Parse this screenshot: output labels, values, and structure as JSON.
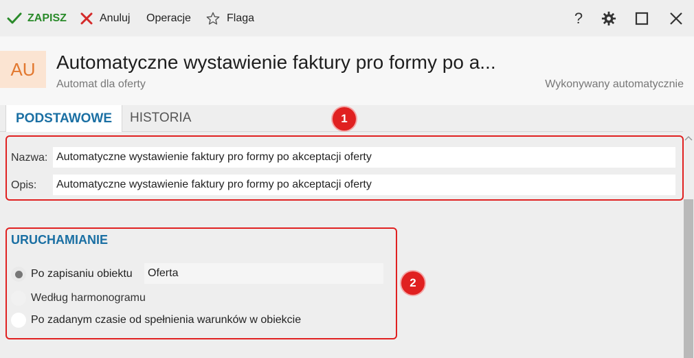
{
  "toolbar": {
    "save_label": "ZAPISZ",
    "cancel_label": "Anuluj",
    "operations_label": "Operacje",
    "flag_label": "Flaga"
  },
  "header": {
    "avatar_initials": "AU",
    "title": "Automatyczne wystawienie faktury pro formy po a...",
    "subtitle": "Automat dla oferty",
    "execution_mode": "Wykonywany automatycznie"
  },
  "tabs": [
    {
      "label": "PODSTAWOWE",
      "active": true
    },
    {
      "label": "HISTORIA",
      "active": false
    }
  ],
  "fields": {
    "name_label": "Nazwa:",
    "name_value": "Automatyczne wystawienie faktury pro formy po akceptacji oferty",
    "description_label": "Opis:",
    "description_value": "Automatyczne wystawienie faktury pro formy po akceptacji oferty"
  },
  "triggering": {
    "section_title": "URUCHAMIANIE",
    "options": [
      {
        "label": "Po zapisaniu obiektu",
        "selected": true
      },
      {
        "label": "Według harmonogramu",
        "selected": false
      },
      {
        "label": "Po zadanym czasie od spełnienia warunków w obiekcie",
        "selected": false
      }
    ],
    "object_value": "Oferta"
  },
  "annotations": {
    "badge_1": "1",
    "badge_2": "2"
  },
  "colors": {
    "accent_blue": "#1a6fa3",
    "save_green": "#2a8a2a",
    "cancel_red": "#d42a2a",
    "annotation_red": "#e02020",
    "avatar_bg": "#fbe4d2",
    "avatar_fg": "#e2782f"
  },
  "icons": {
    "save": "check-icon",
    "cancel": "x-icon",
    "flag": "star-icon",
    "help": "question-icon",
    "settings": "gear-icon",
    "maximize": "maximize-icon",
    "close": "close-icon"
  }
}
